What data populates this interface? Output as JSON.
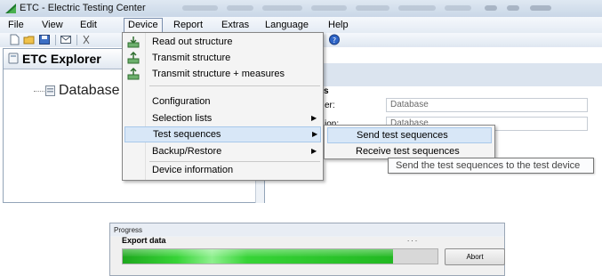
{
  "window": {
    "title": "ETC - Electric Testing Center"
  },
  "menubar": {
    "items": [
      "File",
      "View",
      "Edit",
      "Device",
      "Report",
      "Extras",
      "Language",
      "Help"
    ]
  },
  "explorer": {
    "title": "ETC Explorer",
    "tree_root": "Database"
  },
  "properties": {
    "heading": "s",
    "rows": [
      {
        "label": "er:",
        "value": "Database"
      },
      {
        "label": "ion:",
        "value": "Database"
      }
    ]
  },
  "device_menu": {
    "items": [
      {
        "label": "Read out structure",
        "icon": "download-icon"
      },
      {
        "label": "Transmit structure",
        "icon": "upload-icon"
      },
      {
        "label": "Transmit structure + measures",
        "icon": "upload-icon"
      },
      {
        "label": "Configuration"
      },
      {
        "label": "Selection lists",
        "submenu": true
      },
      {
        "label": "Test sequences",
        "submenu": true,
        "highlighted": true
      },
      {
        "label": "Backup/Restore",
        "submenu": true
      },
      {
        "label": "Device information"
      }
    ]
  },
  "test_sequences_submenu": {
    "items": [
      {
        "label": "Send test sequences",
        "highlighted": true
      },
      {
        "label": "Receive test sequences"
      }
    ]
  },
  "tooltip": {
    "text": "Send the test sequences to the test device"
  },
  "progress_dialog": {
    "title": "Progress",
    "label": "Export data",
    "dots": ". . .",
    "progress_fraction": 0.86,
    "abort_label": "Abort"
  },
  "colors": {
    "progress_fill": "#2fc62f",
    "menu_highlight": "#d8e7f7",
    "menu_highlight_border": "#a8c8ea"
  }
}
